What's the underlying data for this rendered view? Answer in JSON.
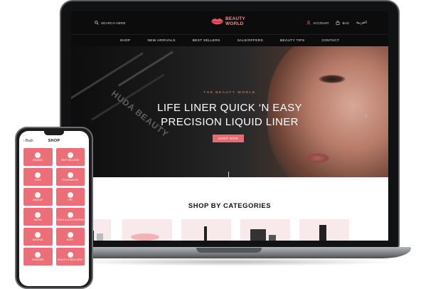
{
  "laptop": {
    "header": {
      "search_label": "SEARCH HERE",
      "logo_line1": "BEAUTY",
      "logo_line2": "WORLD",
      "account_label": "ACCOUNT",
      "bag_label": "BAG",
      "language_label": "العربية"
    },
    "nav": [
      "SHOP",
      "NEW ARRIVALS",
      "BEST SELLERS",
      "SALE/OFFERS",
      "BEAUTY TIPS",
      "CONTACT"
    ],
    "hero": {
      "kicker": "THE BEAUTY WORLD",
      "title_line1": "LIFE LINER QUICK ‘N EASY",
      "title_line2": "PRECISION LIQUID LINER",
      "cta": "SHOP NOW",
      "next_arrow": "›",
      "brand_watermark": "HUDA BEAUTY"
    },
    "categories_title": "SHOP BY CATEGORIES"
  },
  "phone": {
    "back_label": "Back",
    "title": "SHOP",
    "tiles": [
      {
        "label": "BRANDS",
        "icon": "brand-icon"
      },
      {
        "label": "BEST SELLERS",
        "icon": "star-icon"
      },
      {
        "label": "EYES",
        "icon": "eye-icon"
      },
      {
        "label": "FRAGRANCES",
        "icon": "perfume-icon"
      },
      {
        "label": "MAKEUP",
        "icon": "makeup-icon"
      },
      {
        "label": "LIPS",
        "icon": "lips-icon"
      },
      {
        "label": "BATHS",
        "icon": "bath-icon"
      },
      {
        "label": "TOOLS & ACCESSORIES",
        "icon": "tools-icon"
      },
      {
        "label": "NATURAL",
        "icon": "leaf-icon"
      },
      {
        "label": "BODY",
        "icon": "body-icon"
      },
      {
        "label": "SKINCARE",
        "icon": "skincare-icon"
      },
      {
        "label": "HEALTH & WELLNESS",
        "icon": "wellness-icon"
      }
    ]
  },
  "colors": {
    "accent": "#ec6e76",
    "header_bg": "#0c0c0c",
    "logo": "#f18a91"
  }
}
